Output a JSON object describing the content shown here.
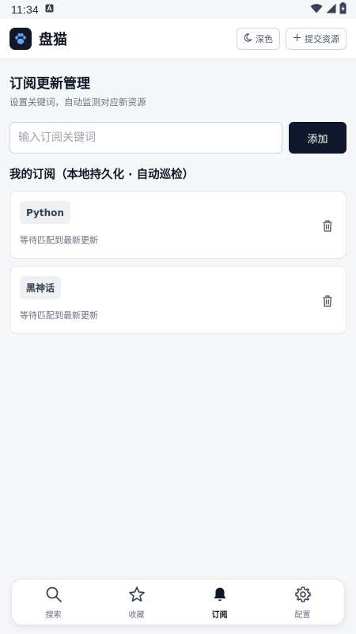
{
  "status_bar": {
    "time": "11:34",
    "icons": [
      "notification-a-icon",
      "wifi-icon",
      "signal-icon",
      "battery-icon"
    ]
  },
  "header": {
    "app_name": "盘猫",
    "logo_icon": "paw-icon",
    "theme_button": {
      "label": "深色",
      "icon": "moon-icon"
    },
    "submit_button": {
      "label": "提交资源",
      "icon": "plus-icon"
    }
  },
  "main": {
    "title": "订阅更新管理",
    "subtitle": "设置关键词，自动监测对应新资源",
    "keyword_input": {
      "value": "",
      "placeholder": "输入订阅关键词"
    },
    "add_button": "添加",
    "section_title": "我的订阅（本地持久化 · 自动巡检）",
    "subscriptions": [
      {
        "keyword": "Python",
        "status": "等待匹配到最新更新"
      },
      {
        "keyword": "黑神话",
        "status": "等待匹配到最新更新"
      }
    ]
  },
  "bottom_nav": {
    "items": [
      {
        "label": "搜索",
        "icon": "search-icon",
        "active": false
      },
      {
        "label": "收藏",
        "icon": "star-icon",
        "active": false
      },
      {
        "label": "订阅",
        "icon": "bell-icon",
        "active": true
      },
      {
        "label": "配置",
        "icon": "gear-icon",
        "active": false
      }
    ]
  },
  "colors": {
    "primary": "#0f172a",
    "background": "#f6f7f9",
    "card": "#ffffff",
    "border": "#e5e7eb",
    "muted_text": "#6b7280"
  }
}
